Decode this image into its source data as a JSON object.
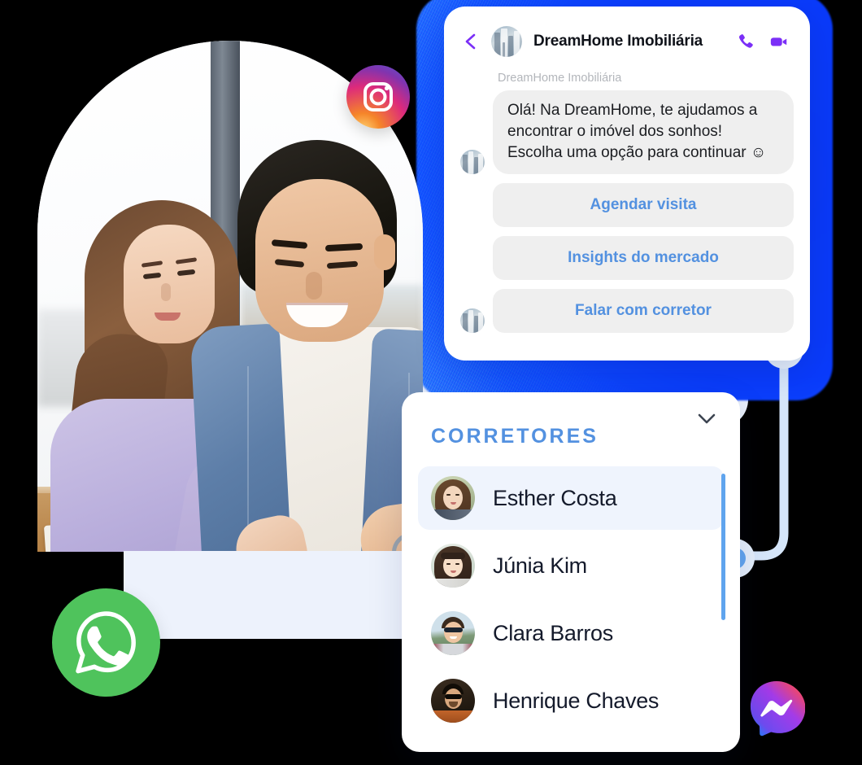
{
  "chat": {
    "title": "DreamHome Imobiliária",
    "back_icon": "chevron-left-icon",
    "avatar_icon": "company-avatar",
    "actions": [
      {
        "name": "call-button",
        "icon": "phone-icon",
        "color": "#7B2FF7"
      },
      {
        "name": "video-call-button",
        "icon": "video-camera-icon",
        "color": "#7B2FF7"
      }
    ],
    "sender_label": "DreamHome Imobiliária",
    "message": "Olá! Na DreamHome, te ajudamos a encontrar o imóvel dos sonhos! Escolha uma opção para continuar ☺",
    "quick_replies": [
      "Agendar visita",
      "Insights do mercado",
      "Falar com corretor"
    ],
    "bubble_bg": "#EFEFEF",
    "quick_reply_color": "#5391E0"
  },
  "corretores": {
    "title": "CORRETORES",
    "title_color": "#5391E0",
    "collapse_icon": "chevron-down-icon",
    "agents": [
      {
        "name": "Esther Costa",
        "selected": true
      },
      {
        "name": "Júnia Kim",
        "selected": false
      },
      {
        "name": "Clara Barros",
        "selected": false
      },
      {
        "name": "Henrique Chaves",
        "selected": false
      }
    ],
    "selected_row_bg": "#EFF4FD",
    "scrollbar_color": "#5FA4EE"
  },
  "social": [
    {
      "name": "instagram-badge",
      "label": "Instagram"
    },
    {
      "name": "whatsapp-badge",
      "label": "WhatsApp",
      "color": "#4FC35C"
    },
    {
      "name": "messenger-badge",
      "label": "Messenger"
    }
  ],
  "decor": {
    "glow_color": "#0B39F5",
    "panel_color": "#EDF2FC",
    "node_color": "#62A5EE",
    "hero_photo_alt": "Casal sorrindo olhando para um laptop"
  }
}
